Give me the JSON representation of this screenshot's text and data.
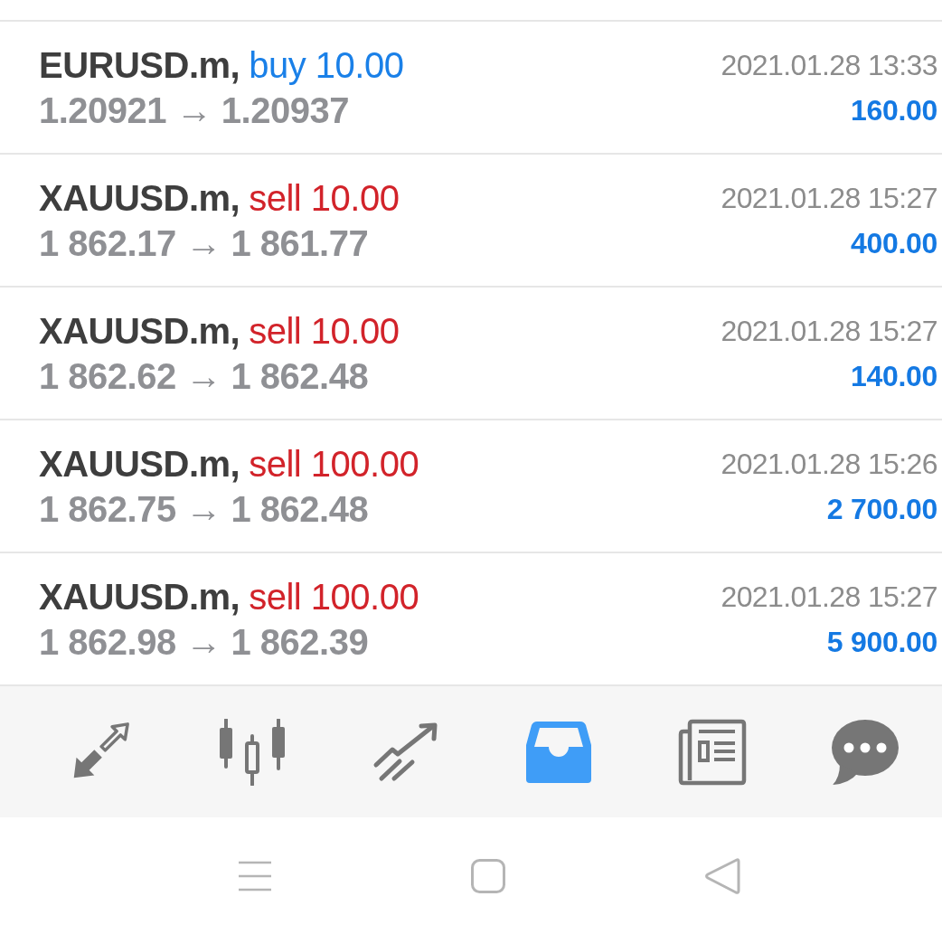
{
  "trades": [
    {
      "symbol": "EURUSD.m,",
      "kind": "buy",
      "deal": "buy 10.00",
      "prices": "**1.20921** → **1.20937**",
      "time": "2021.01.28 13:33",
      "profit": "160.00"
    },
    {
      "symbol": "XAUUSD.m,",
      "kind": "sell",
      "deal": "sell 10.00",
      "prices": "**1 862.17** → **1 861.77**",
      "time": "2021.01.28 15:27",
      "profit": "400.00"
    },
    {
      "symbol": "XAUUSD.m,",
      "kind": "sell",
      "deal": "sell 10.00",
      "prices": "**1 862.62** → **1 862.48**",
      "time": "2021.01.28 15:27",
      "profit": "140.00"
    },
    {
      "symbol": "XAUUSD.m,",
      "kind": "sell",
      "deal": "sell 100.00",
      "prices": "**1 862.75** → **1 862.48**",
      "time": "2021.01.28 15:26",
      "profit": "2 700.00"
    },
    {
      "symbol": "XAUUSD.m,",
      "kind": "sell",
      "deal": "sell 100.00",
      "prices": "**1 862.98** → **1 862.39**",
      "time": "2021.01.28 15:27",
      "profit": "5 900.00"
    }
  ],
  "bottom_nav": {
    "tabs": [
      {
        "selected": false
      },
      {
        "selected": false
      },
      {
        "selected": false
      },
      {
        "selected": true
      },
      {
        "selected": false
      },
      {
        "selected": false
      }
    ]
  }
}
